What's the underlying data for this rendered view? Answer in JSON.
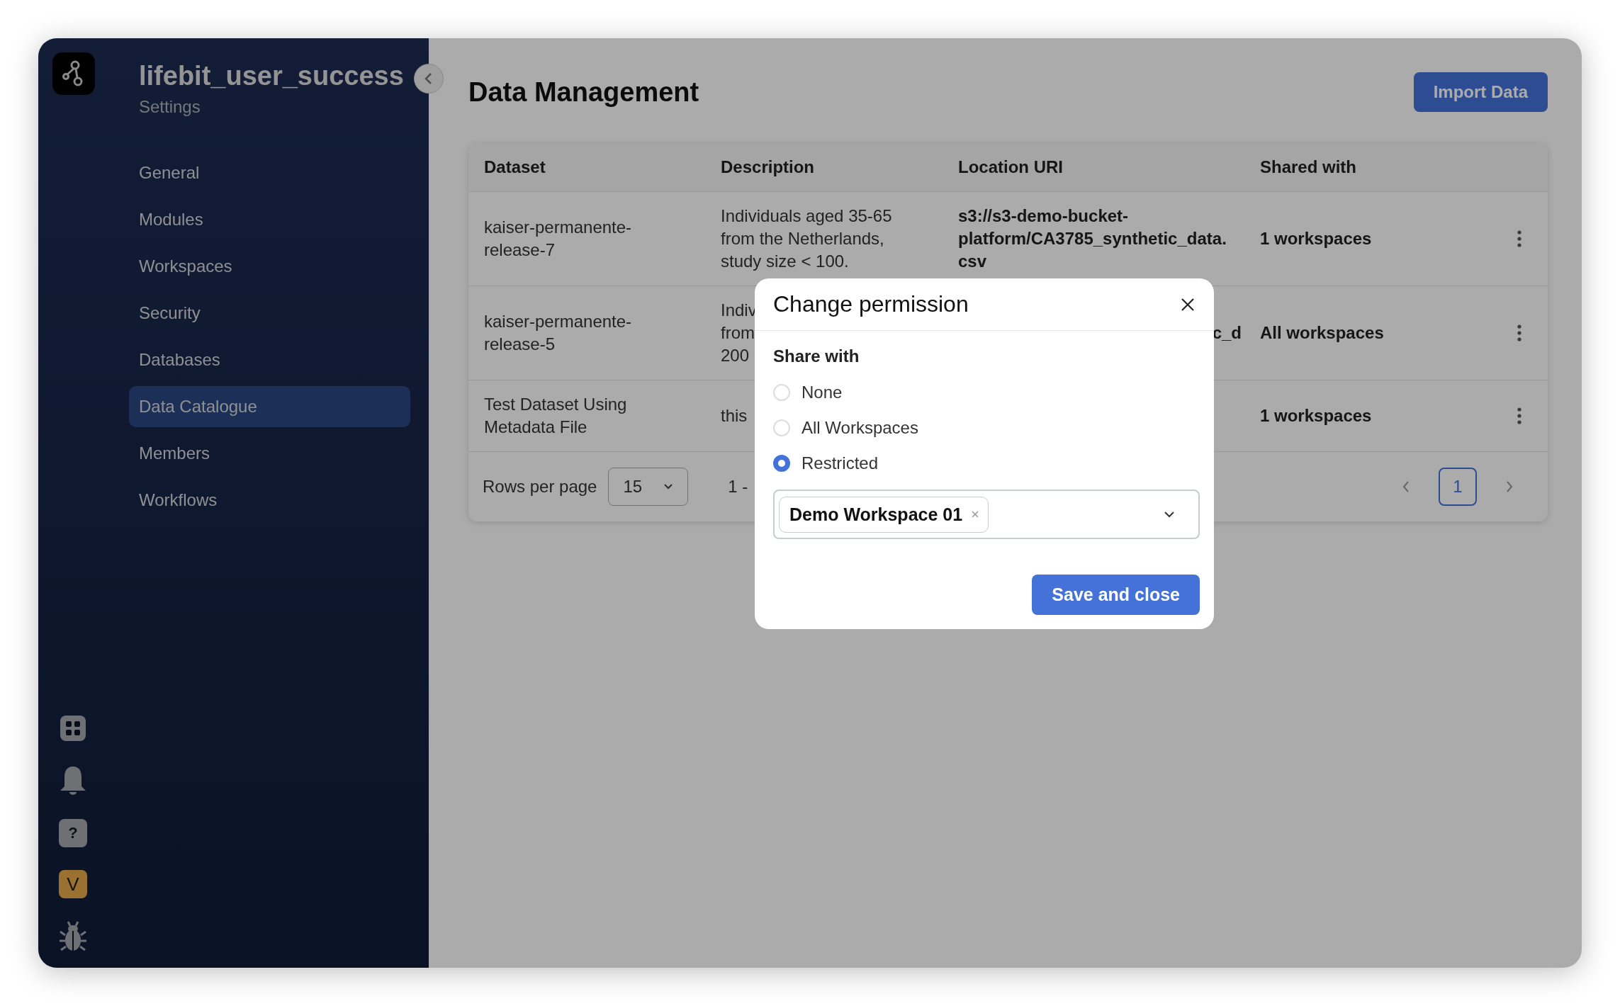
{
  "sidebar": {
    "workspace": "lifebit_user_success",
    "subtitle": "Settings",
    "items": [
      {
        "label": "General",
        "selected": false
      },
      {
        "label": "Modules",
        "selected": false
      },
      {
        "label": "Workspaces",
        "selected": false
      },
      {
        "label": "Security",
        "selected": false
      },
      {
        "label": "Databases",
        "selected": false
      },
      {
        "label": "Data Catalogue",
        "selected": true
      },
      {
        "label": "Members",
        "selected": false
      },
      {
        "label": "Workflows",
        "selected": false
      }
    ],
    "bottom_icons": [
      {
        "kind": "apps"
      },
      {
        "kind": "bell"
      },
      {
        "kind": "help",
        "label": "?"
      },
      {
        "kind": "avatar",
        "label": "V"
      },
      {
        "kind": "bug"
      }
    ]
  },
  "page": {
    "title": "Data Management",
    "import_button": "Import Data"
  },
  "table": {
    "columns": [
      "Dataset",
      "Description",
      "Location URI",
      "Shared with"
    ],
    "rows": [
      {
        "location_clipped": false,
        "dataset": "kaiser-permanente-release-7",
        "description": [
          "Individuals aged 35-65",
          "from the Netherlands,",
          "study size < 100."
        ],
        "location": [
          "s3://s3-demo-bucket-",
          "platform/CA3785_synthetic_data.",
          "csv"
        ],
        "shared_with": "1 workspaces"
      },
      {
        "location_clipped": true,
        "dataset": "kaiser-permanente-release-5",
        "description": [
          "Indiv",
          "from",
          "200"
        ],
        "location": [
          "c_d"
        ],
        "shared_with": "All workspaces"
      },
      {
        "dataset": "Test Dataset Using Metadata File",
        "description": [
          "this"
        ],
        "location": [],
        "shared_with": "1 workspaces"
      }
    ],
    "footer": {
      "rows_per_page_label": "Rows per page",
      "rows_per_page": "15",
      "range": "1 -",
      "pages": [
        {
          "label": "1",
          "selected": true
        }
      ]
    }
  },
  "modal": {
    "title": "Change permission",
    "share_label": "Share with",
    "options": [
      {
        "label": "None",
        "selected": false
      },
      {
        "label": "All Workspaces",
        "selected": false
      },
      {
        "label": "Restricted",
        "selected": true
      }
    ],
    "chips": [
      {
        "label": "Demo Workspace 01"
      }
    ],
    "save_button": "Save and close"
  }
}
